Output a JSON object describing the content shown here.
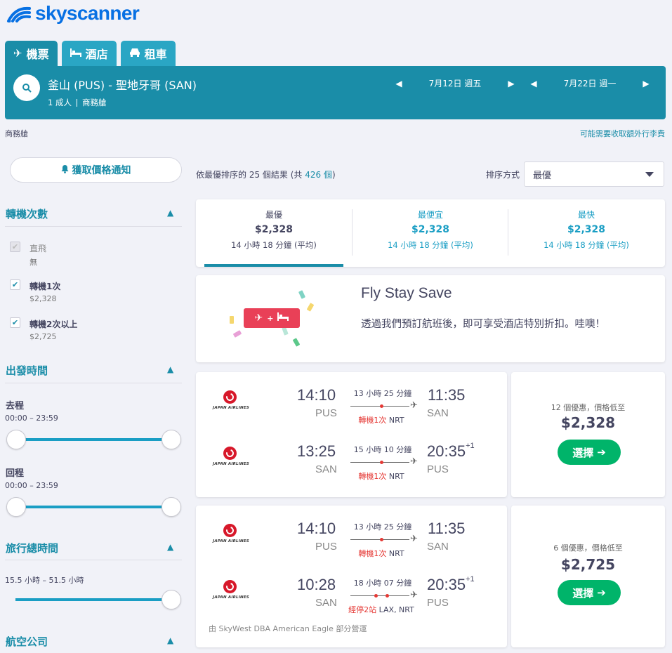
{
  "logo": {
    "text": "skyscanner"
  },
  "tabs": [
    {
      "label": "機票",
      "icon": "plane-icon"
    },
    {
      "label": "酒店",
      "icon": "bed-icon"
    },
    {
      "label": "租車",
      "icon": "car-icon"
    }
  ],
  "search": {
    "route": "釜山 (PUS) - 聖地牙哥 (SAN)",
    "passengers": "1 成人",
    "cabin": "商務艙",
    "depart_date": "7月12日 週五",
    "return_date": "7月22日 週一"
  },
  "cabin_label": "商務艙",
  "extra_fee_link": "可能需要收取額外行李費",
  "price_alert_label": "獲取價格通知",
  "filters": {
    "stops": {
      "title": "轉機次數",
      "options": [
        {
          "label": "直飛",
          "sub": "無",
          "checked": true,
          "disabled": true
        },
        {
          "label": "轉機1次",
          "sub": "$2,328",
          "checked": true
        },
        {
          "label": "轉機2次以上",
          "sub": "$2,725",
          "checked": true
        }
      ]
    },
    "departure_times": {
      "title": "出發時間",
      "outbound_label": "去程",
      "outbound_range": "00:00 – 23:59",
      "return_label": "回程",
      "return_range": "00:00 – 23:59"
    },
    "duration": {
      "title": "旅行總時間",
      "range": "15.5 小時 – 51.5 小時"
    },
    "airlines": {
      "title": "航空公司"
    }
  },
  "results": {
    "prefix": "依最優排序的 25 個結果 (共 ",
    "total": "426 個",
    "suffix": ")"
  },
  "sort": {
    "label": "排序方式",
    "value": "最優"
  },
  "sort_tabs": [
    {
      "title": "最優",
      "price": "$2,328",
      "duration": "14 小時 18 分鐘 (平均)"
    },
    {
      "title": "最便宜",
      "price": "$2,328",
      "duration": "14 小時 18 分鐘 (平均)"
    },
    {
      "title": "最快",
      "price": "$2,328",
      "duration": "14 小時 18 分鐘 (平均)"
    }
  ],
  "promo": {
    "title": "Fly Stay Save",
    "description": "透過我們預訂航班後，即可享受酒店特別折扣。哇噢！"
  },
  "flights": [
    {
      "airline": "JAPAN AIRLINES",
      "legs": [
        {
          "dep_time": "14:10",
          "dep_code": "PUS",
          "duration": "13 小時 25 分鐘",
          "arr_time": "11:35",
          "arr_code": "SAN",
          "stops_text": "轉機1次",
          "via": "NRT",
          "day_offset": ""
        },
        {
          "dep_time": "13:25",
          "dep_code": "SAN",
          "duration": "15 小時 10 分鐘",
          "arr_time": "20:35",
          "arr_code": "PUS",
          "stops_text": "轉機1次",
          "via": "NRT",
          "day_offset": "+1"
        }
      ],
      "deals": "12 個優惠，價格低至",
      "price": "$2,328",
      "select_label": "選擇"
    },
    {
      "airline": "JAPAN AIRLINES",
      "legs": [
        {
          "dep_time": "14:10",
          "dep_code": "PUS",
          "duration": "13 小時 25 分鐘",
          "arr_time": "11:35",
          "arr_code": "SAN",
          "stops_text": "轉機1次",
          "via": "NRT",
          "day_offset": ""
        },
        {
          "dep_time": "10:28",
          "dep_code": "SAN",
          "duration": "18 小時 07 分鐘",
          "arr_time": "20:35",
          "arr_code": "PUS",
          "stops_text": "經停2站",
          "via": "LAX, NRT",
          "day_offset": "+1"
        }
      ],
      "operated_by": "由 SkyWest DBA American Eagle 部分營運",
      "deals": "6 個優惠，價格低至",
      "price": "$2,725",
      "select_label": "選擇"
    }
  ],
  "colors": {
    "brand": "#0770e3",
    "teal": "#1a8da8",
    "select_green": "#00b46a",
    "stop_red": "#e53935"
  }
}
